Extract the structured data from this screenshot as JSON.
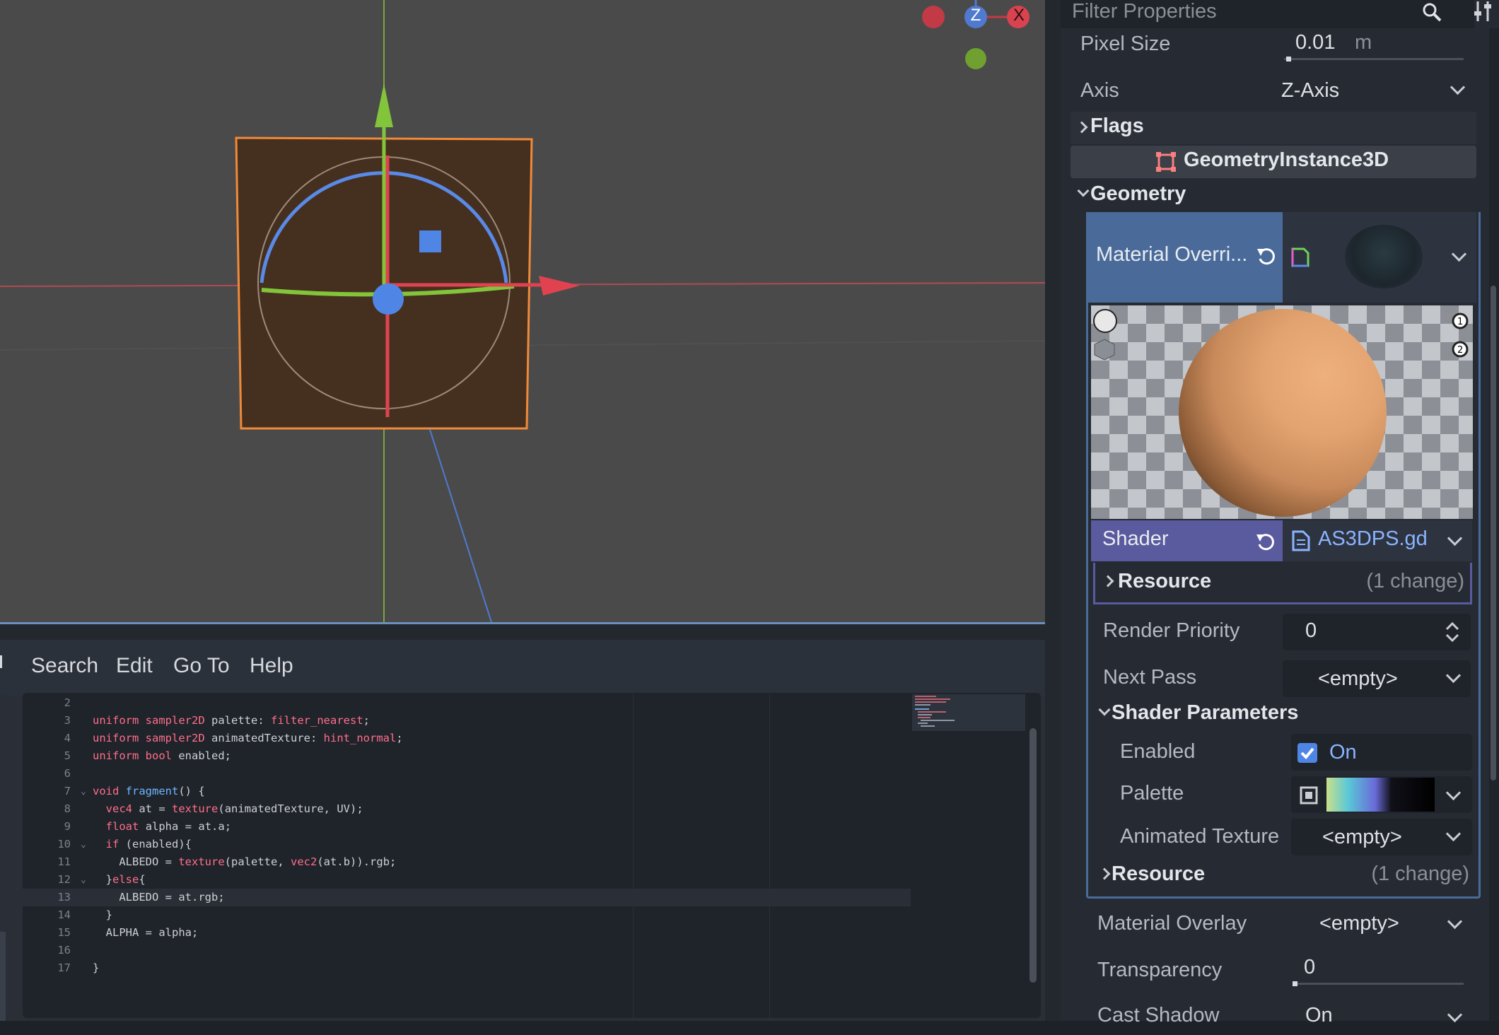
{
  "menu": [
    "Search",
    "Edit",
    "Go To",
    "Help"
  ],
  "gizmo": {
    "z_label": "Z",
    "x_label": "X"
  },
  "code": {
    "lines": [
      {
        "n": "2",
        "text": ""
      },
      {
        "n": "3",
        "text": "uniform sampler2D palette: filter_nearest;"
      },
      {
        "n": "4",
        "text": "uniform sampler2D animatedTexture: hint_normal;"
      },
      {
        "n": "5",
        "text": "uniform bool enabled;"
      },
      {
        "n": "6",
        "text": ""
      },
      {
        "n": "7",
        "text": "void fragment() {"
      },
      {
        "n": "8",
        "text": "  vec4 at = texture(animatedTexture, UV);"
      },
      {
        "n": "9",
        "text": "  float alpha = at.a;"
      },
      {
        "n": "10",
        "text": "  if (enabled){"
      },
      {
        "n": "11",
        "text": "    ALBEDO = texture(palette, vec2(at.b)).rgb;"
      },
      {
        "n": "12",
        "text": "  }else{"
      },
      {
        "n": "13",
        "text": "    ALBEDO = at.rgb;"
      },
      {
        "n": "14",
        "text": "  }"
      },
      {
        "n": "15",
        "text": "  ALPHA = alpha;"
      },
      {
        "n": "16",
        "text": ""
      },
      {
        "n": "17",
        "text": "}"
      }
    ],
    "current_line": "13"
  },
  "inspector": {
    "filter_placeholder": "Filter Properties",
    "pixel_size": {
      "label": "Pixel Size",
      "value": "0.01",
      "unit": "m",
      "fill": 0.01
    },
    "axis": {
      "label": "Axis",
      "value": "Z-Axis"
    },
    "flags": "Flags",
    "class_header": "GeometryInstance3D",
    "geometry": "Geometry",
    "material_override": {
      "label": "Material Overri..."
    },
    "shader": {
      "label": "Shader",
      "value": "AS3DPS.gd"
    },
    "resource1": {
      "label": "Resource",
      "changes": "(1 change)"
    },
    "render_priority": {
      "label": "Render Priority",
      "value": "0"
    },
    "next_pass": {
      "label": "Next Pass",
      "value": "<empty>"
    },
    "shader_parameters": "Shader Parameters",
    "enabled": {
      "label": "Enabled",
      "value": "On",
      "checked": true
    },
    "palette": {
      "label": "Palette"
    },
    "animated_texture": {
      "label": "Animated Texture",
      "value": "<empty>"
    },
    "resource2": {
      "label": "Resource",
      "changes": "(1 change)"
    },
    "material_overlay": {
      "label": "Material Overlay",
      "value": "<empty>"
    },
    "transparency": {
      "label": "Transparency",
      "value": "0",
      "fill": 0.0
    },
    "cast_shadow": {
      "label": "Cast Shadow",
      "value": "On"
    }
  },
  "colors": {
    "accent": "#6d8fbf",
    "x_axis": "#e0434f",
    "y_axis": "#8ac43a",
    "z_axis": "#4f86e6",
    "selection": "#f08a3a",
    "shader_row": "#5a5a9e",
    "material_row": "#4a6b9a"
  }
}
